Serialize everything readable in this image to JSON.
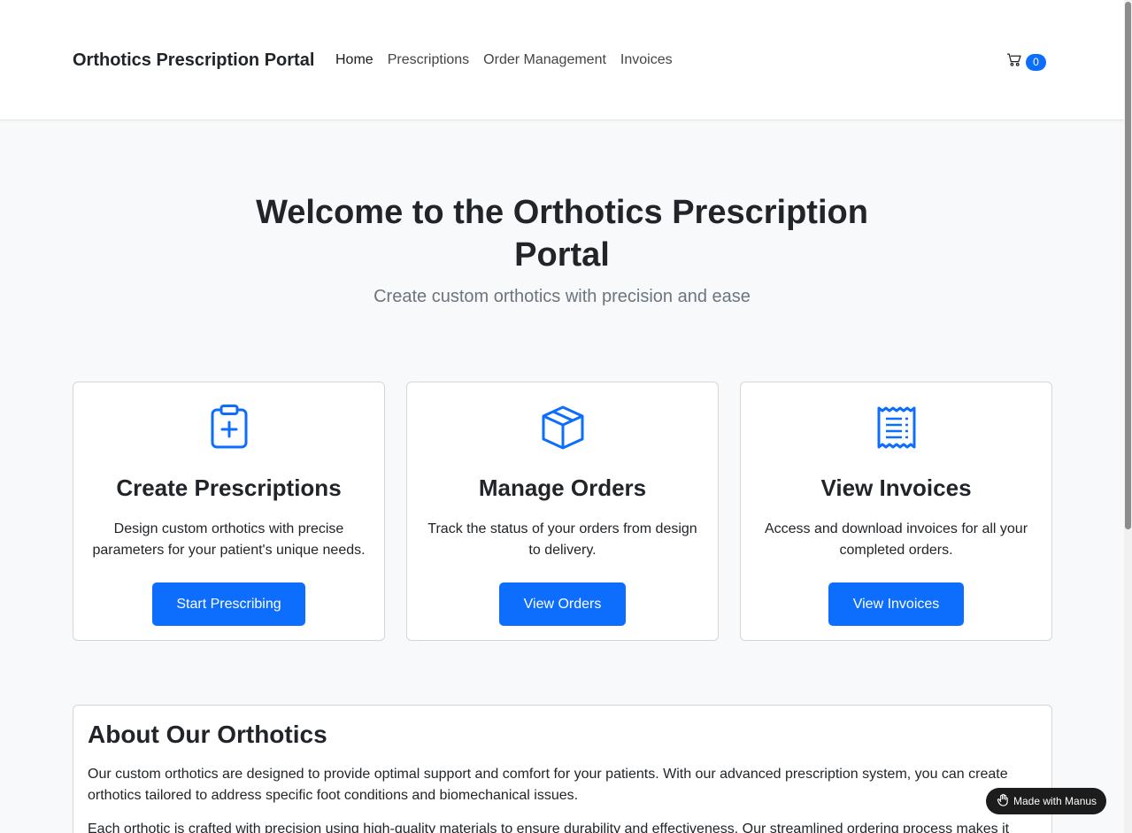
{
  "navbar": {
    "brand": "Orthotics Prescription Portal",
    "links": [
      {
        "label": "Home"
      },
      {
        "label": "Prescriptions"
      },
      {
        "label": "Order Management"
      },
      {
        "label": "Invoices"
      }
    ],
    "cart_icon": "cart-icon",
    "cart_count": "0"
  },
  "hero": {
    "title": "Welcome to the Orthotics Prescription Portal",
    "subtitle": "Create custom orthotics with precision and ease"
  },
  "cards": [
    {
      "icon": "clipboard-plus-icon",
      "title": "Create Prescriptions",
      "text": "Design custom orthotics with precise parameters for your patient's unique needs.",
      "button": "Start Prescribing"
    },
    {
      "icon": "box-icon",
      "title": "Manage Orders",
      "text": "Track the status of your orders from design to delivery.",
      "button": "View Orders"
    },
    {
      "icon": "receipt-icon",
      "title": "View Invoices",
      "text": "Access and download invoices for all your completed orders.",
      "button": "View Invoices"
    }
  ],
  "about": {
    "title": "About Our Orthotics",
    "p1": "Our custom orthotics are designed to provide optimal support and comfort for your patients. With our advanced prescription system, you can create orthotics tailored to address specific foot conditions and biomechanical issues.",
    "p2": "Each orthotic is crafted with precision using high-quality materials to ensure durability and effectiveness. Our streamlined ordering process makes it"
  },
  "badge": {
    "label": "Made with Manus",
    "icon": "manus-hand-icon"
  },
  "colors": {
    "accent": "#0d6efd",
    "background": "#f8f9fa"
  }
}
